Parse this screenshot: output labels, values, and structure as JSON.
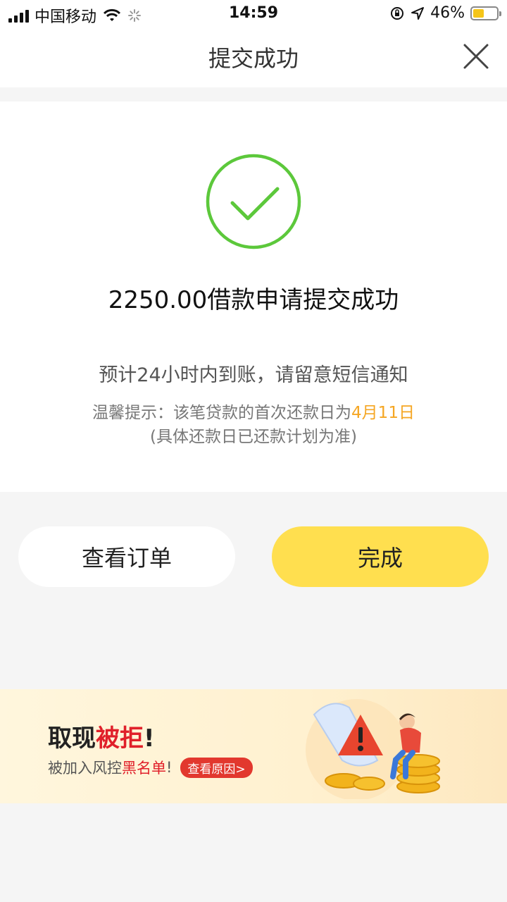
{
  "status_bar": {
    "carrier": "中国移动",
    "time": "14:59",
    "battery_percent": "46%",
    "battery_level": 0.46,
    "icons": [
      "signal-icon",
      "wifi-icon",
      "loading-icon",
      "rotation-lock-icon",
      "location-icon",
      "battery-icon"
    ]
  },
  "nav": {
    "title": "提交成功",
    "close_icon": "close-icon"
  },
  "result": {
    "status_icon": "check-circle-icon",
    "headline": "2250.00借款申请提交成功",
    "notice": "预计24小时内到账，请留意短信通知",
    "tip_prefix": "温馨提示：该笔贷款的首次还款日为",
    "tip_date": "4月11日",
    "tip_note": "(具体还款日已还款计划为准)"
  },
  "actions": {
    "view_order": "查看订单",
    "done": "完成"
  },
  "banner": {
    "title_prefix": "取现",
    "title_highlight": "被拒",
    "title_suffix": "!",
    "sub_prefix": "被加入风控",
    "sub_highlight": "黑名单",
    "sub_suffix": "!",
    "button": "查看原因>",
    "illustration": "warning-coins-illustration"
  },
  "colors": {
    "accent_yellow": "#ffdf4f",
    "success_green": "#5cc83b",
    "highlight_orange": "#f5a623",
    "alert_red": "#e0202a"
  }
}
